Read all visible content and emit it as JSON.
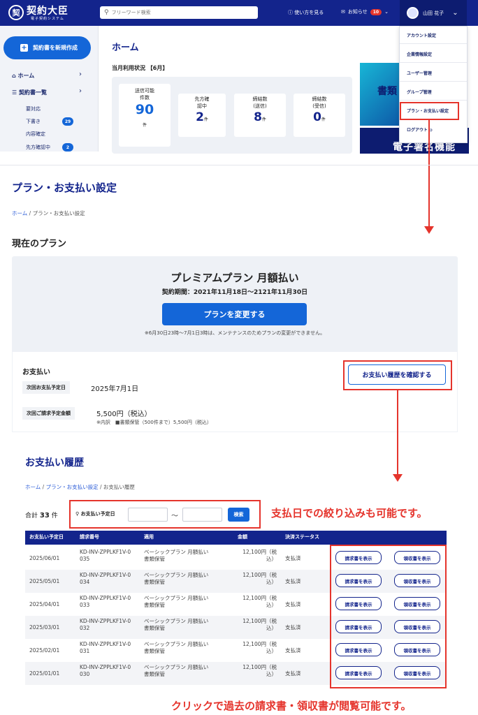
{
  "app": {
    "logo_mark": "契",
    "logo_text": "契約大臣",
    "logo_sub": "電子契約システム",
    "search_placeholder": "フリーワード検索",
    "howto": "使い方を見る",
    "notice_label": "お知らせ",
    "notice_count": "10",
    "user_name": "山田 花子"
  },
  "sidebar": {
    "new_contract": "契約書を新規作成",
    "home": "ホーム",
    "contract_list": "契約書一覧",
    "subitems": [
      "要対応",
      "下書き",
      "内容確定",
      "先方確認中"
    ],
    "draft_count": "29",
    "pending_count": "2"
  },
  "home": {
    "title": "ホーム",
    "usage_title": "当月利用状況 【6月】",
    "stats": [
      {
        "label": "送信可能\n件数",
        "value": "90",
        "unit": "件"
      },
      {
        "label": "先方確\n認中",
        "value": "2",
        "unit": "件"
      },
      {
        "label": "締結数\n(送信)",
        "value": "8",
        "unit": "件"
      },
      {
        "label": "締結数\n(受信)",
        "value": "0",
        "unit": "件"
      }
    ],
    "banner1_text": "書類",
    "banner2_text": "電子署名機能"
  },
  "user_menu": {
    "items": [
      "アカウント設定",
      "企業情報設定",
      "ユーザー管理",
      "グループ管理",
      "プラン・お支払い設定",
      "ログアウト"
    ]
  },
  "plan_page": {
    "title": "プラン・お支払い設定",
    "breadcrumb_home": "ホーム",
    "breadcrumb_current": "プラン・お支払い設定",
    "current_plan_heading": "現在のプラン",
    "plan_name": "プレミアムプラン 月額払い",
    "plan_period": "契約期間：2021年11月18日〜2121年11月30日",
    "change_button": "プランを変更する",
    "maintenance_note": "※6月30日23時〜7月1日3時は、メンテナンスのためプランの変更ができません。",
    "payment_heading": "お支払い",
    "next_payment_label": "次回お支払予定日",
    "next_payment_value": "2025年7月1日",
    "next_billing_label": "次回ご請求予定金額",
    "next_billing_value": "5,500円（税込）",
    "billing_breakdown": "※内訳　■書類保管（500件まで）5,500円（税込）",
    "history_button": "お支払い履歴を確認する"
  },
  "history_page": {
    "title": "お支払い履歴",
    "breadcrumb": [
      "ホーム",
      "プラン・お支払い設定",
      "お支払い履歴"
    ],
    "total_label": "合計",
    "total_count": "33",
    "total_unit": "件",
    "filter_label": "お支払い予定日",
    "tilde": "〜",
    "search_button": "検索",
    "note_filter": "支払日での絞り込みも可能です。",
    "note_click": "クリックで過去の請求書・領収書が閲覧可能です。",
    "columns": [
      "お支払い予定日",
      "請求番号",
      "適用",
      "金額",
      "決済ステータス"
    ],
    "invoice_button": "請求書を表示",
    "receipt_button": "領収書を表示",
    "rows": [
      {
        "date": "2025/06/01",
        "number": "KD-INV-ZPPLKF1V-0\n035",
        "desc": "ベーシックプラン 月額払い\n書類保管",
        "amount": "12,100円（税\n込）",
        "status": "支払済"
      },
      {
        "date": "2025/05/01",
        "number": "KD-INV-ZPPLKF1V-0\n034",
        "desc": "ベーシックプラン 月額払い\n書類保管",
        "amount": "12,100円（税\n込）",
        "status": "支払済"
      },
      {
        "date": "2025/04/01",
        "number": "KD-INV-ZPPLKF1V-0\n033",
        "desc": "ベーシックプラン 月額払い\n書類保管",
        "amount": "12,100円（税\n込）",
        "status": "支払済"
      },
      {
        "date": "2025/03/01",
        "number": "KD-INV-ZPPLKF1V-0\n032",
        "desc": "ベーシックプラン 月額払い\n書類保管",
        "amount": "12,100円（税\n込）",
        "status": "支払済"
      },
      {
        "date": "2025/02/01",
        "number": "KD-INV-ZPPLKF1V-0\n031",
        "desc": "ベーシックプラン 月額払い\n書類保管",
        "amount": "12,100円（税\n込）",
        "status": "支払済"
      },
      {
        "date": "2025/01/01",
        "number": "KD-INV-ZPPLKF1V-0\n030",
        "desc": "ベーシックプラン 月額払い\n書類保管",
        "amount": "12,100円（税\n込）",
        "status": "支払済"
      }
    ]
  },
  "colors": {
    "navy": "#13248c",
    "blue": "#1466d8",
    "red_annotation": "#e5342c"
  }
}
